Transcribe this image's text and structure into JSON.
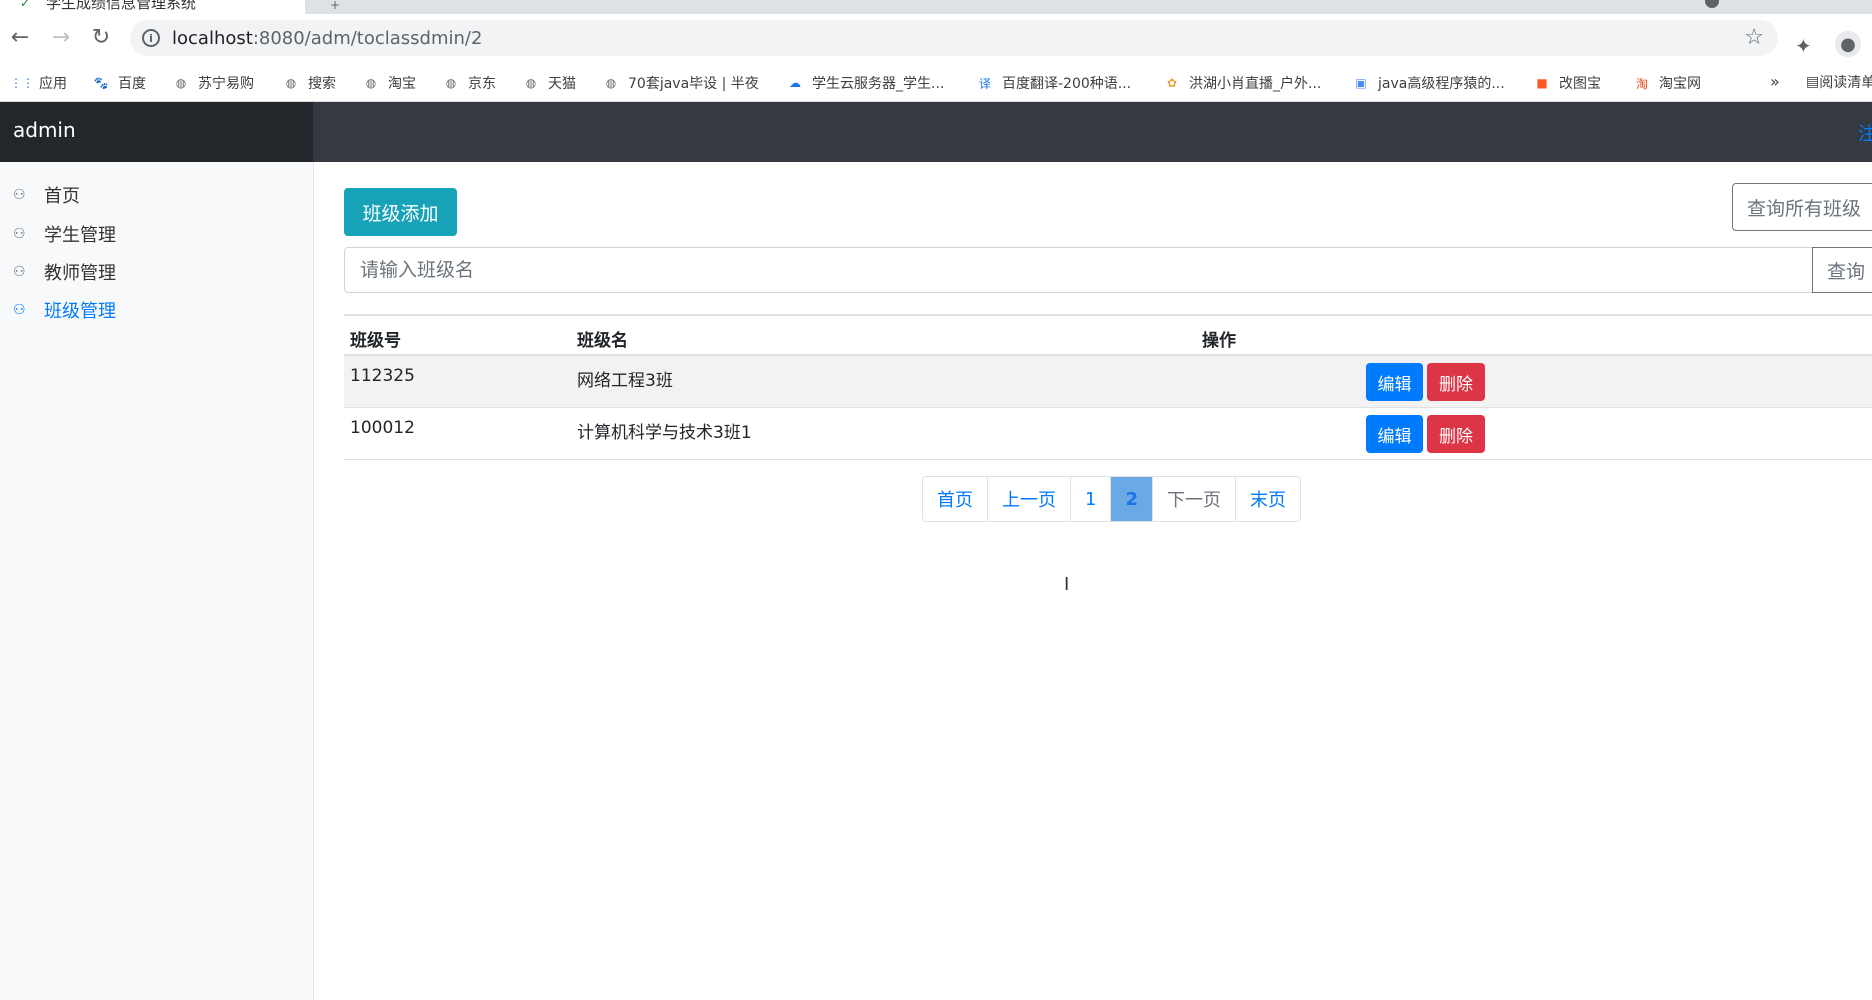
{
  "browser": {
    "tab_title": "学生成绩信息管理系统",
    "url_host": "localhost",
    "url_rest": ":8080/adm/toclassdmin/2",
    "bookmarks": [
      {
        "label": "应用"
      },
      {
        "label": "百度"
      },
      {
        "label": "苏宁易购"
      },
      {
        "label": "搜索"
      },
      {
        "label": "淘宝"
      },
      {
        "label": "京东"
      },
      {
        "label": "天猫"
      },
      {
        "label": "70套java毕设 | 半夜"
      },
      {
        "label": "学生云服务器_学生..."
      },
      {
        "label": "百度翻译-200种语..."
      },
      {
        "label": "洪湖小肖直播_户外..."
      },
      {
        "label": "java高级程序猿的..."
      },
      {
        "label": "改图宝"
      },
      {
        "label": "淘宝网"
      }
    ],
    "more_label": "»",
    "reading_label": "阅读清单"
  },
  "navbar": {
    "brand": "admin",
    "signout": "注销"
  },
  "sidebar": {
    "items": [
      {
        "label": "首页",
        "active": false
      },
      {
        "label": "学生管理",
        "active": false
      },
      {
        "label": "教师管理",
        "active": false
      },
      {
        "label": "班级管理",
        "active": true
      }
    ]
  },
  "main": {
    "add_button": "班级添加",
    "query_all_button": "查询所有班级",
    "search": {
      "placeholder": "请输入班级名",
      "button": "查询"
    },
    "table": {
      "headers": [
        "班级号",
        "班级名",
        "操作"
      ],
      "rows": [
        {
          "id": "112325",
          "name": "网络工程3班"
        },
        {
          "id": "100012",
          "name": "计算机科学与技术3班1"
        }
      ],
      "edit_label": "编辑",
      "delete_label": "删除"
    },
    "pagination": {
      "first": "首页",
      "prev": "上一页",
      "pages": [
        "1",
        "2"
      ],
      "current": "2",
      "next": "下一页",
      "last": "末页"
    }
  },
  "colors": {
    "navbar_bg": "#343a40",
    "brand_bg": "#23272b",
    "add_button": "#17a2b8",
    "edit_button": "#007bff",
    "delete_button": "#dc3545",
    "active_link": "#007bff"
  }
}
